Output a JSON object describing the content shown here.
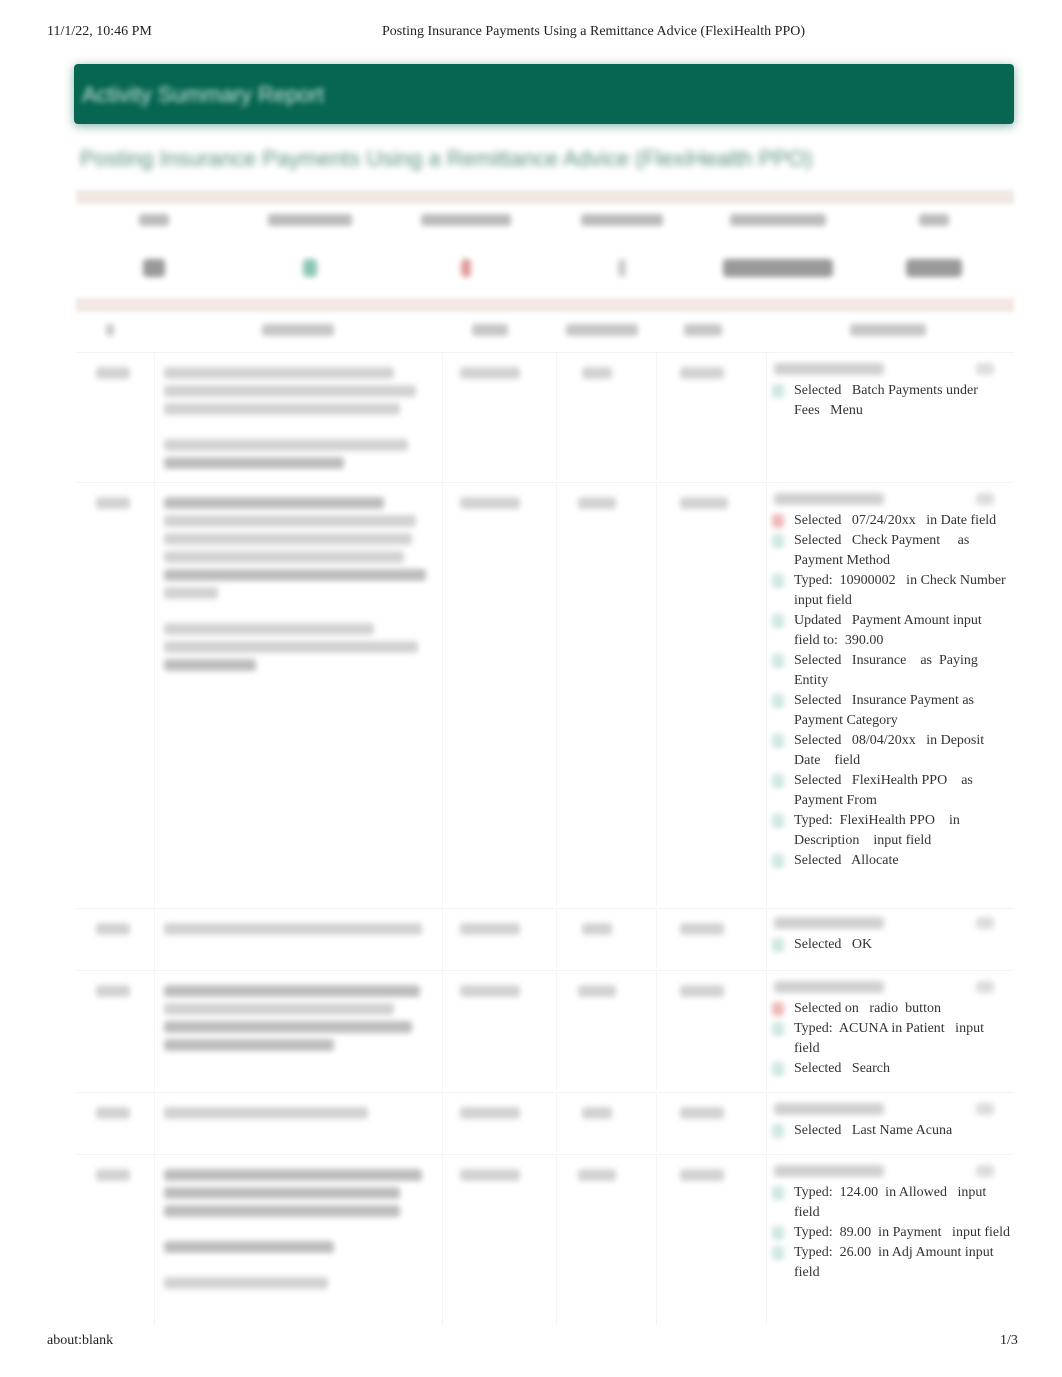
{
  "print_header": {
    "datetime": "11/1/22, 10:46 PM",
    "document_title": "Posting Insurance Payments Using a Remittance Advice (FlexiHealth PPO)"
  },
  "print_footer": {
    "url": "about:blank",
    "page_indicator": "1/3"
  },
  "report": {
    "banner_title": "Activity Summary Report",
    "subtitle": "Posting Insurance Payments Using a Remittance Advice (FlexiHealth PPO)",
    "colors": {
      "banner": "#066651",
      "rule": "#f1e8e3",
      "success_marker": "#cfe7e2",
      "error_marker": "#f0b8b8"
    }
  },
  "steps": [
    {
      "actions": [
        {
          "status": "ok",
          "text": "Selected   Batch Payments under  Fees   Menu"
        }
      ]
    },
    {
      "actions": [
        {
          "status": "err",
          "text": "Selected   07/24/20xx   in Date field"
        },
        {
          "status": "ok",
          "text": "Selected   Check Payment     as Payment Method"
        },
        {
          "status": "ok",
          "text": "Typed:  10900002   in Check Number   input field"
        },
        {
          "status": "ok",
          "text": "Updated   Payment Amount input field to:  390.00"
        },
        {
          "status": "ok",
          "text": "Selected   Insurance    as  Paying Entity"
        },
        {
          "status": "ok",
          "text": "Selected   Insurance Payment as  Payment Category"
        },
        {
          "status": "ok",
          "text": "Selected   08/04/20xx   in Deposit Date    field"
        },
        {
          "status": "ok",
          "text": "Selected   FlexiHealth PPO    as Payment From"
        },
        {
          "status": "ok",
          "text": "Typed:  FlexiHealth PPO    in Description    input field"
        },
        {
          "status": "ok",
          "text": "Selected   Allocate"
        }
      ]
    },
    {
      "actions": [
        {
          "status": "ok",
          "text": "Selected   OK"
        }
      ]
    },
    {
      "actions": [
        {
          "status": "err",
          "text": "Selected on   radio  button"
        },
        {
          "status": "ok",
          "text": "Typed:  ACUNA in Patient   input field"
        },
        {
          "status": "ok",
          "text": "Selected   Search"
        }
      ]
    },
    {
      "actions": [
        {
          "status": "ok",
          "text": "Selected   Last Name Acuna"
        }
      ]
    },
    {
      "actions": [
        {
          "status": "ok",
          "text": "Typed:  124.00  in Allowed   input field"
        },
        {
          "status": "ok",
          "text": "Typed:  89.00  in Payment   input field"
        },
        {
          "status": "ok",
          "text": "Typed:  26.00  in Adj Amount input field"
        }
      ]
    }
  ]
}
